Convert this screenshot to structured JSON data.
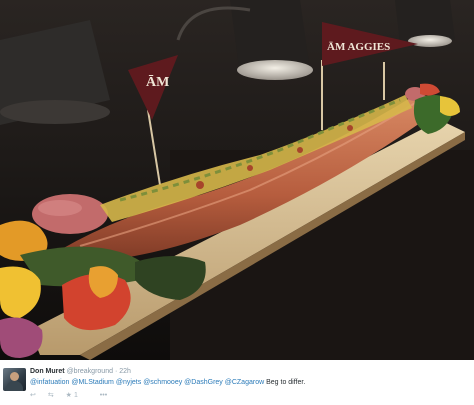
{
  "photo": {
    "description_icon": "photo",
    "pennants": [
      {
        "text": "ĀM"
      },
      {
        "text": "ĀM AGGIES"
      }
    ]
  },
  "tweet": {
    "author": "Don Muret",
    "handle": "@breakground",
    "separator": "·",
    "time": "22h",
    "mentions": [
      "@infatuation",
      "@MLStadium",
      "@nyjets",
      "@schmooey",
      "@DashGrey",
      "@CZagarow"
    ],
    "text_suffix": "Beg to differ.",
    "actions": {
      "reply_icon": "reply-icon",
      "retweet_icon": "retweet-icon",
      "favorite_icon": "favorite-icon",
      "favorite_count": "1",
      "more_icon": "more-icon"
    }
  },
  "colors": {
    "mention": "#2b7bb9",
    "maroon": "#6b1e22",
    "bun": "#c0694a"
  }
}
